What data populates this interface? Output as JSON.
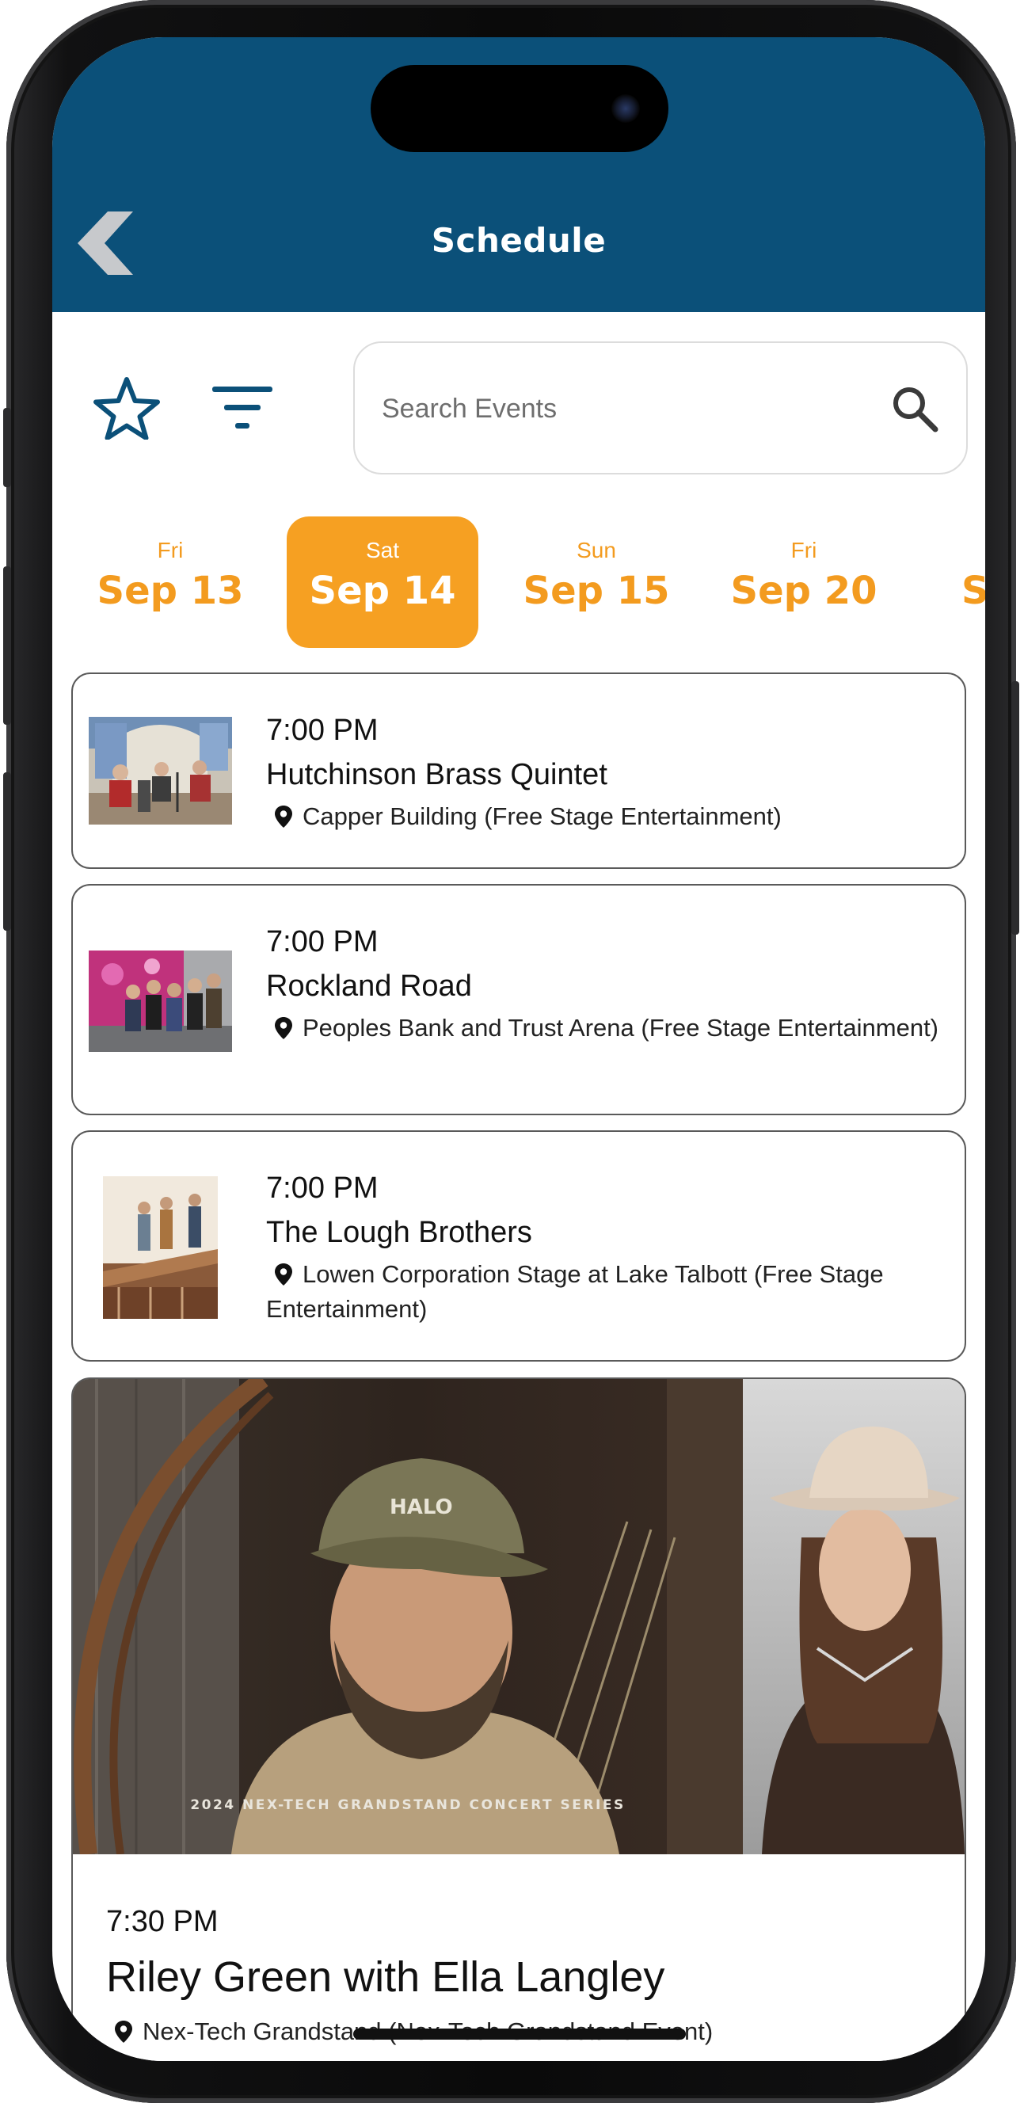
{
  "header": {
    "title": "Schedule",
    "bg_color": "#0b5079"
  },
  "toolbar": {
    "favorites_icon": "star-outline-icon",
    "filter_icon": "filter-lines-icon",
    "search_placeholder": "Search Events",
    "search_value": ""
  },
  "dates": [
    {
      "dow": "Fri",
      "day": "Sep 13",
      "selected": false
    },
    {
      "dow": "Sat",
      "day": "Sep 14",
      "selected": true
    },
    {
      "dow": "Sun",
      "day": "Sep 15",
      "selected": false
    },
    {
      "dow": "Fri",
      "day": "Sep 20",
      "selected": false
    },
    {
      "dow": "",
      "day": "Se",
      "selected": false
    }
  ],
  "events": [
    {
      "time": "7:00 PM",
      "title": "Hutchinson Brass Quintet",
      "location": "Capper Building (Free Stage Entertainment)"
    },
    {
      "time": "7:00 PM",
      "title": "Rockland Road",
      "location": "Peoples Bank and Trust Arena (Free Stage Entertainment)"
    },
    {
      "time": "7:00 PM",
      "title": "The Lough Brothers",
      "location": "Lowen Corporation Stage at Lake Talbott (Free Stage Entertainment)"
    }
  ],
  "featured": {
    "banner_caption": "2024 NEX-TECH GRANDSTAND CONCERT SERIES",
    "cap_text": "HALO",
    "time": "7:30 PM",
    "title": "Riley Green with Ella Langley",
    "location": "Nex-Tech Grandstand (Nex-Tech Grandstand Event)"
  },
  "colors": {
    "accent": "#f6a022",
    "accent_text": "#f39b1f",
    "icon_blue": "#0b5079"
  }
}
